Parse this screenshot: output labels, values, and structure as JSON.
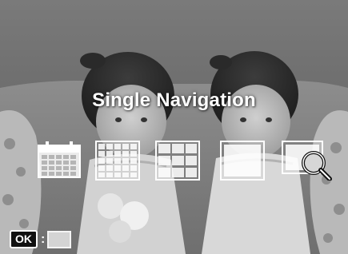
{
  "screen": {
    "title": "Single Navigation",
    "modes": [
      {
        "icon": "calendar-view-icon"
      },
      {
        "icon": "thumbnail-grid-small-icon"
      },
      {
        "icon": "thumbnail-grid-large-icon"
      },
      {
        "icon": "single-view-icon"
      },
      {
        "icon": "zoom-view-icon"
      }
    ],
    "hint": {
      "key_label": "OK",
      "separator": ":"
    }
  },
  "colors": {
    "overlay_icon": "#ffffff",
    "title_text": "#ffffff"
  }
}
